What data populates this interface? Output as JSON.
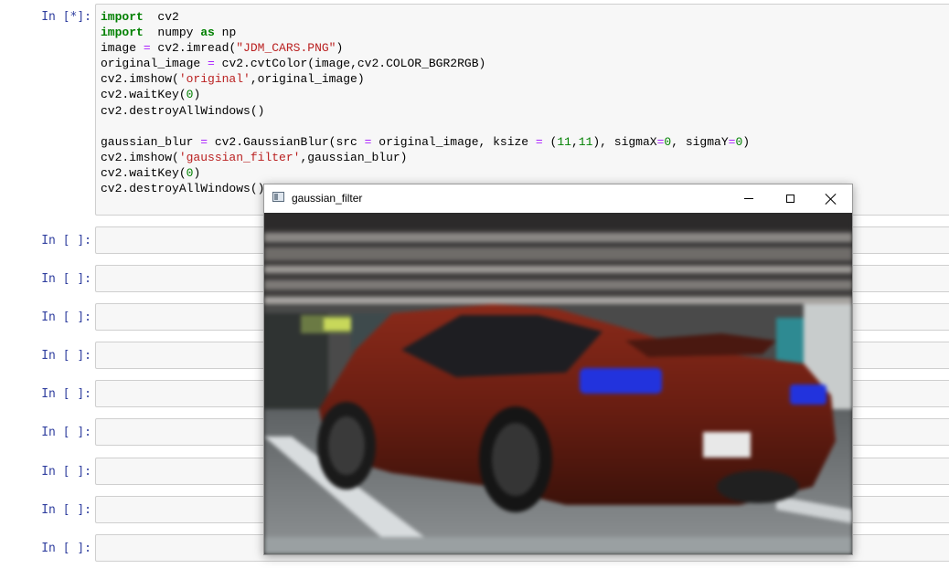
{
  "cells": [
    {
      "prompt": "In [*]:",
      "code": [
        [
          [
            "kw",
            "import"
          ],
          [
            "",
            "  cv2"
          ]
        ],
        [
          [
            "kw",
            "import"
          ],
          [
            "",
            "  numpy "
          ],
          [
            "kw",
            "as"
          ],
          [
            "",
            " np"
          ]
        ],
        [
          [
            "",
            "image "
          ],
          [
            "op",
            "="
          ],
          [
            "",
            " cv2.imread("
          ],
          [
            "str",
            "\"JDM_CARS.PNG\""
          ],
          [
            "",
            ")"
          ]
        ],
        [
          [
            "",
            "original_image "
          ],
          [
            "op",
            "="
          ],
          [
            "",
            " cv2.cvtColor(image,cv2.COLOR_BGR2RGB)"
          ]
        ],
        [
          [
            "",
            "cv2.imshow("
          ],
          [
            "str",
            "'original'"
          ],
          [
            "",
            ",original_image)"
          ]
        ],
        [
          [
            "",
            "cv2.waitKey("
          ],
          [
            "num",
            "0"
          ],
          [
            "",
            ")"
          ]
        ],
        [
          [
            "",
            "cv2.destroyAllWindows()"
          ]
        ],
        [
          [
            "",
            ""
          ]
        ],
        [
          [
            "",
            "gaussian_blur "
          ],
          [
            "op",
            "="
          ],
          [
            "",
            " cv2.GaussianBlur(src "
          ],
          [
            "op",
            "="
          ],
          [
            "",
            " original_image, ksize "
          ],
          [
            "op",
            "="
          ],
          [
            "",
            " ("
          ],
          [
            "num",
            "11"
          ],
          [
            "",
            ","
          ],
          [
            "num",
            "11"
          ],
          [
            "",
            "), sigmaX"
          ],
          [
            "op",
            "="
          ],
          [
            "num",
            "0"
          ],
          [
            "",
            ", sigmaY"
          ],
          [
            "op",
            "="
          ],
          [
            "num",
            "0"
          ],
          [
            "",
            ")"
          ]
        ],
        [
          [
            "",
            "cv2.imshow("
          ],
          [
            "str",
            "'gaussian_filter'"
          ],
          [
            "",
            ",gaussian_blur)"
          ]
        ],
        [
          [
            "",
            "cv2.waitKey("
          ],
          [
            "num",
            "0"
          ],
          [
            "",
            ")"
          ]
        ],
        [
          [
            "",
            "cv2.destroyAllWindows()"
          ]
        ]
      ]
    },
    {
      "prompt": "In [ ]:"
    },
    {
      "prompt": "In [ ]:"
    },
    {
      "prompt": "In [ ]:"
    },
    {
      "prompt": "In [ ]:"
    },
    {
      "prompt": "In [ ]:"
    },
    {
      "prompt": "In [ ]:"
    },
    {
      "prompt": "In [ ]:"
    },
    {
      "prompt": "In [ ]:"
    },
    {
      "prompt": "In [ ]:"
    }
  ],
  "cv_window": {
    "title": "gaussian_filter",
    "icons": {
      "app": "opencv-window-icon",
      "minimize": "minimize-icon",
      "maximize": "maximize-icon",
      "close": "close-icon"
    }
  },
  "colors": {
    "prompt": "#303f9f",
    "keyword": "#008000",
    "string": "#ba2121",
    "operator": "#aa22ff",
    "cell_bg": "#f7f7f7"
  }
}
